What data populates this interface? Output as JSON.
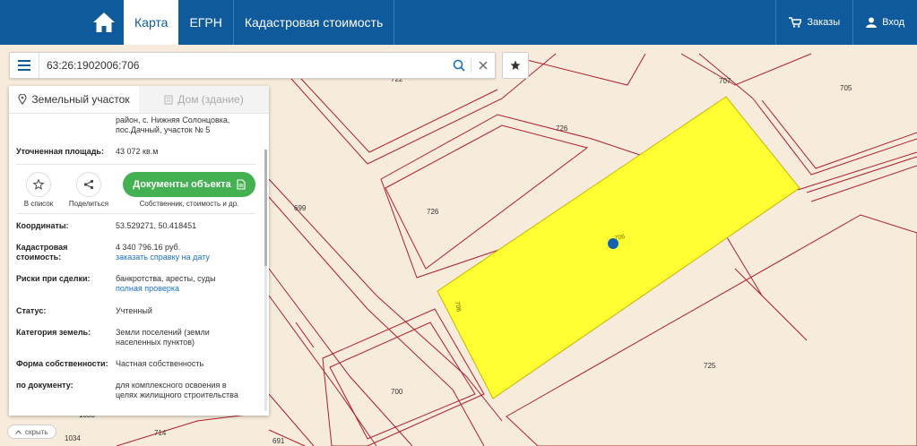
{
  "nav": {
    "map": "Карта",
    "egrn": "ЕГРН",
    "cadastral_value": "Кадастровая стоимость",
    "orders": "Заказы",
    "login": "Вход"
  },
  "search": {
    "value": "63:26:1902006:706"
  },
  "panel": {
    "tab_land": "Земельный участок",
    "tab_house": "Дом (здание)",
    "address_partial": [
      "район, с. Нижняя Солонцовка,",
      "пос.Дачный, участок № 5"
    ],
    "area": {
      "label": "Уточненная площадь:",
      "value": "43 072 кв.м"
    },
    "actions": {
      "favorite": "В список",
      "share": "Поделиться"
    },
    "docs_button": "Документы объекта",
    "docs_sub": "Собственник, стоимость и др.",
    "coords": {
      "label": "Координаты:",
      "value": "53.529271, 50.418451"
    },
    "cad_value": {
      "label_1": "Кадастровая",
      "label_2": "стоимость:",
      "value": "4 340 796.16 руб.",
      "link": "заказать справку на дату"
    },
    "risks": {
      "label": "Риски при сделки:",
      "value": "банкротства, аресты, суды",
      "link": "полная проверка"
    },
    "status": {
      "label": "Статус:",
      "value": "Учтенный"
    },
    "category": {
      "label": "Категория земель:",
      "value_1": "Земли поселений (земли",
      "value_2": "населенных пунктов)"
    },
    "ownership": {
      "label": "Форма собственности:",
      "value": "Частная собственность"
    },
    "by_doc": {
      "label": "по документу:",
      "value_1": "для комплексного освоения в",
      "value_2": "целях жилищного строительства"
    }
  },
  "hide_label": "скрыть",
  "map_labels": {
    "l722": "722",
    "l707": "707",
    "l705": "705",
    "l726a": "726",
    "l726b": "726",
    "l699": "699",
    "l706": "706",
    "l725": "725",
    "l700": "700",
    "l714": "714",
    "l691": "691",
    "l1034": "1034",
    "l1033": "1033"
  },
  "colors": {
    "nav_bg": "#0f5a9c",
    "parcel_fill": "#ffff33",
    "parcel_line": "#b01e2a",
    "docs_green": "#43b152",
    "map_bg": "#f7ecdc"
  }
}
